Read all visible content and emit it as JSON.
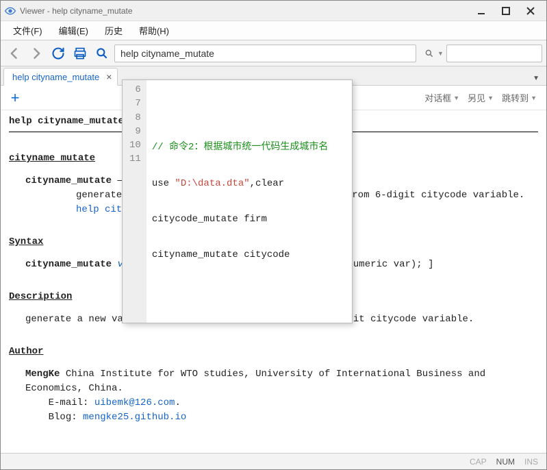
{
  "window": {
    "title": "Viewer - help cityname_mutate"
  },
  "menu": {
    "file": "文件(F)",
    "edit": "编辑(E)",
    "history": "历史",
    "help": "帮助(H)"
  },
  "toolbar": {
    "address_value": "help cityname_mutate",
    "search_placeholder": ""
  },
  "tabs": {
    "t1": {
      "label": "help cityname_mutate"
    }
  },
  "actions": {
    "dialogbox": "对话框",
    "seealso": "另见",
    "jumpto": "跳转到"
  },
  "help": {
    "page_title": "help cityname_mutate",
    "section_title": "cityname_mutate",
    "cmdname": "cityname_mutate",
    "dash": " —",
    "summary_text": "generate a new var to capture China's cityname from 6-digit citycode variable. ",
    "summary_link": "help cityname_mutate",
    "period": ".",
    "syntax_head": "Syntax",
    "syntax_cmd": "cityname_mutate",
    "syntax_varlist": "varlist",
    "syntax_rest": " , [ varlist is 6-digit citycode(numeric var); ]",
    "desc_head": "Description",
    "desc_body": "generate a new var to capture China's cityname from 6-digit citycode variable.",
    "author_head": "Author",
    "author_name": "MengKe",
    "author_affil": " China Institute for WTO studies, University of International Business and Economics, China.",
    "email_label": "E-mail: ",
    "email_link": "uibemk@126.com",
    "blog_label": "Blog: ",
    "blog_link": "mengke25.github.io"
  },
  "popup": {
    "lines": [
      "6",
      "7",
      "8",
      "9",
      "10",
      "11"
    ],
    "l7_comment": "// 命令2：根据城市统一代码生成城市名",
    "l8_a": "use ",
    "l8_str": "\"D:\\data.dta\"",
    "l8_b": ",clear",
    "l9": "citycode_mutate firm",
    "l10": "cityname_mutate citycode"
  },
  "status": {
    "cap": "CAP",
    "num": "NUM",
    "ins": "INS"
  }
}
